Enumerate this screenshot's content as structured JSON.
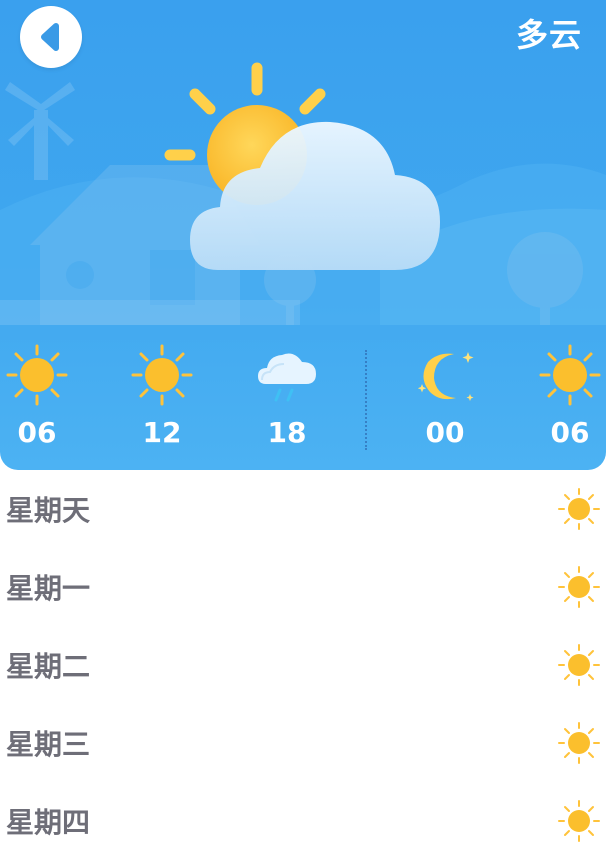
{
  "header": {
    "back_icon": "chevron-left-icon",
    "condition": "多云",
    "main_icon": "partly-cloudy-icon",
    "colors": {
      "sky": "#3fa7ef",
      "sun": "#fbbf2d",
      "cloud": "#dff0fd"
    }
  },
  "hourly": [
    {
      "time": "06",
      "icon": "sun-icon"
    },
    {
      "time": "12",
      "icon": "sun-icon"
    },
    {
      "time": "18",
      "icon": "rain-cloud-icon"
    },
    {
      "time": "00",
      "icon": "moon-icon"
    },
    {
      "time": "06",
      "icon": "sun-icon"
    }
  ],
  "daily": [
    {
      "day": "星期天",
      "icon": "sun-icon"
    },
    {
      "day": "星期一",
      "icon": "sun-icon"
    },
    {
      "day": "星期二",
      "icon": "sun-icon"
    },
    {
      "day": "星期三",
      "icon": "sun-icon"
    },
    {
      "day": "星期四",
      "icon": "sun-icon"
    }
  ]
}
